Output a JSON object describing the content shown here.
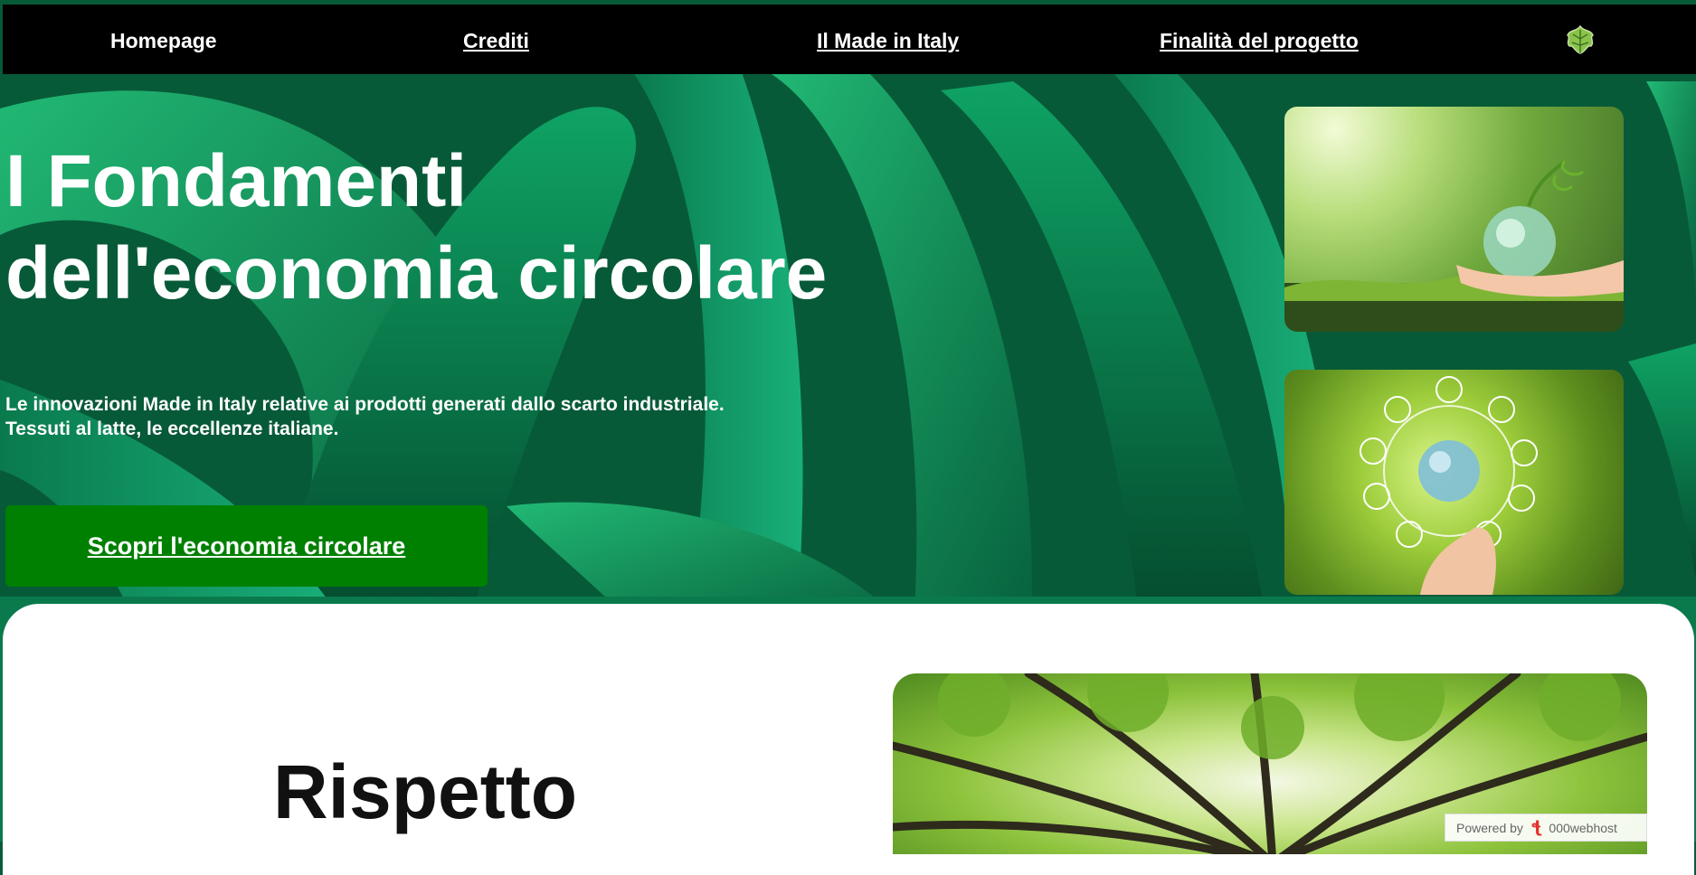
{
  "nav": {
    "items": [
      {
        "label": "Homepage"
      },
      {
        "label": "Crediti"
      },
      {
        "label": "Il Made in Italy"
      },
      {
        "label": "Finalità del progetto"
      }
    ],
    "logo_icon": "leaf-logo-icon"
  },
  "hero": {
    "title_line1": "I Fondamenti",
    "title_line2": "dell'economia circolare",
    "subtitle_line1": "Le innovazioni Made in Italy relative ai prodotti generati dallo scarto industriale.",
    "subtitle_line2": "Tessuti al latte, le eccellenze italiane.",
    "cta_label": "Scopri l'economia circolare"
  },
  "images": {
    "top": "hands-holding-glass-globe-image",
    "bottom": "sustainability-icons-globe-image",
    "forest": "forest-canopy-image"
  },
  "section": {
    "title": "Rispetto"
  },
  "badge": {
    "prefix": "Powered by",
    "brand": "000webhost"
  },
  "colors": {
    "nav_bg": "#000000",
    "cta_bg": "#008000",
    "text_light": "#ffffff"
  }
}
